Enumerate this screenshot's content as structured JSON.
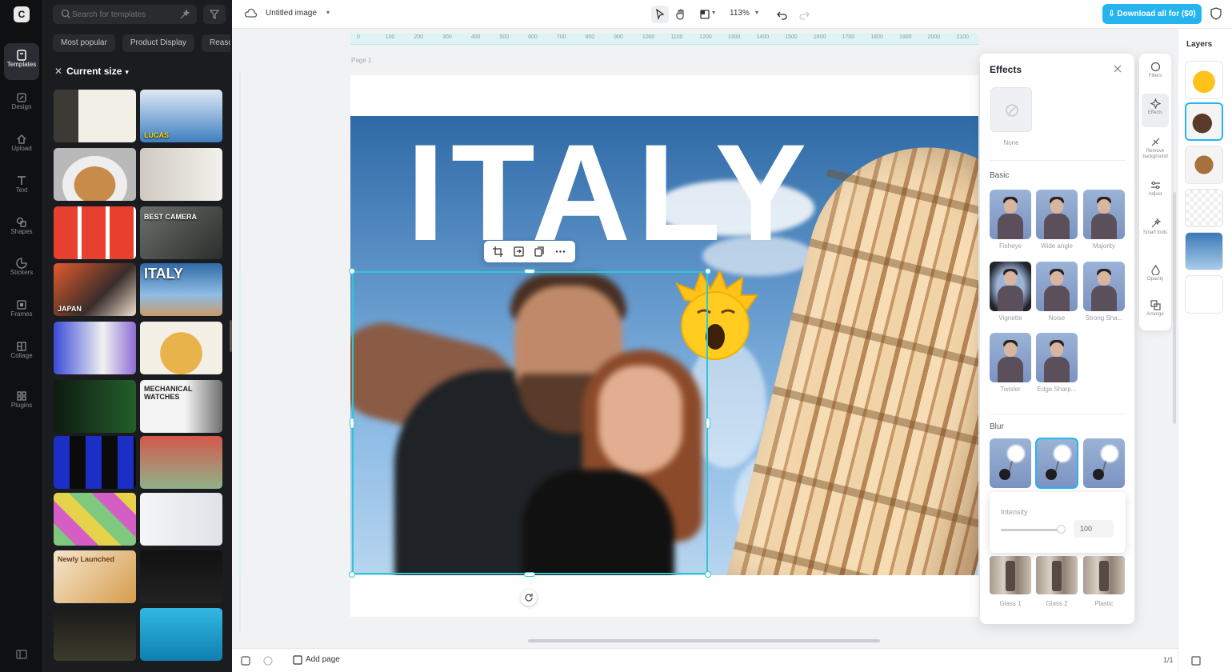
{
  "sidebar": {
    "logo": "C",
    "items": [
      {
        "label": "Templates",
        "icon": "templates-icon",
        "active": true
      },
      {
        "label": "Design",
        "icon": "design-icon"
      },
      {
        "label": "Upload",
        "icon": "upload-icon"
      },
      {
        "label": "Text",
        "icon": "text-icon"
      },
      {
        "label": "Shapes",
        "icon": "shapes-icon"
      },
      {
        "label": "Stickers",
        "icon": "stickers-icon"
      },
      {
        "label": "Frames",
        "icon": "frames-icon"
      },
      {
        "label": "Collage",
        "icon": "collage-icon"
      },
      {
        "label": "Plugins",
        "icon": "plugins-icon"
      }
    ]
  },
  "templates_panel": {
    "search_placeholder": "Search for templates",
    "chips": [
      "Most popular",
      "Product Display",
      "Reaso"
    ],
    "current_size_label": "Current size",
    "thumb_texts": {
      "lucas": "LUCAS",
      "best_camera": "BEST CAMERA",
      "japan": "JAPAN",
      "italy": "ITALY",
      "mechanical": "MECHANICAL WATCHES",
      "ready": "Newly Launched"
    }
  },
  "topbar": {
    "doc_title": "Untitled image",
    "zoom": "113%",
    "download_label": "Download all for ($0)"
  },
  "canvas": {
    "page_label": "Page 1",
    "headline": "ITALY",
    "ruler_ticks": [
      "0",
      "100",
      "200",
      "300",
      "400",
      "500",
      "600",
      "700",
      "800",
      "900",
      "1000",
      "1100",
      "1200",
      "1300",
      "1400",
      "1500",
      "1600",
      "1700",
      "1800",
      "1900",
      "2000",
      "2100"
    ]
  },
  "effects": {
    "title": "Effects",
    "none_label": "None",
    "basic_label": "Basic",
    "basic_items": [
      "Fisheye",
      "Wide angle",
      "Majority",
      "Vignette",
      "Noise",
      "Strong Sha...",
      "Twister",
      "Edge Sharp..."
    ],
    "blur_label": "Blur",
    "intensity_label": "Intensity",
    "intensity_value": "100",
    "intensity_fraction": 1.0,
    "glass_items": [
      "Glass 1",
      "Glass 2",
      "Plastic"
    ]
  },
  "tool_strip": [
    "Filters",
    "Effects",
    "Remove background",
    "Adjust",
    "Smart tools",
    "Opacity",
    "Arrange"
  ],
  "layers": {
    "title": "Layers"
  },
  "bottombar": {
    "add_page": "Add page",
    "page_count": "1/1"
  },
  "colors": {
    "accent": "#26b4ef",
    "selection": "#2ec6d4",
    "rail_bg": "#0f1012",
    "panel_bg": "#1b1c1f"
  }
}
